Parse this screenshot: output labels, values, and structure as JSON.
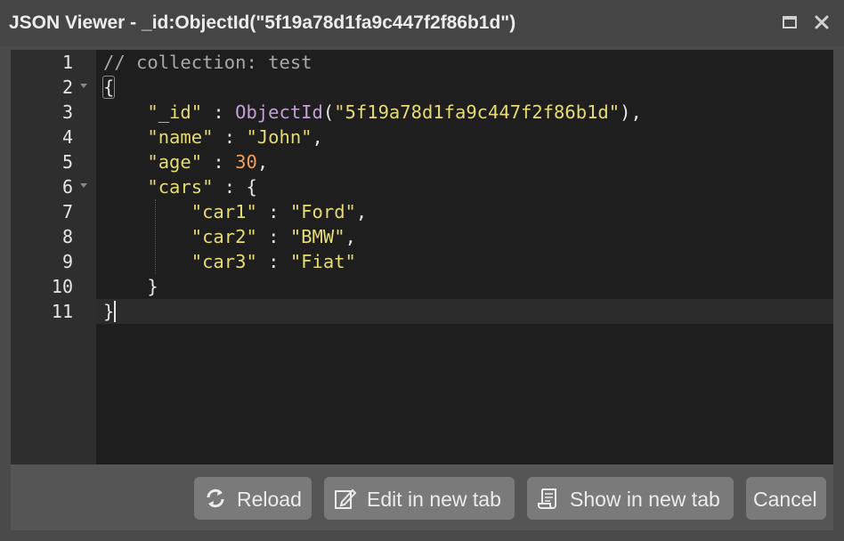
{
  "window": {
    "title": "JSON Viewer - _id:ObjectId(\"5f19a78d1fa9c447f2f86b1d\")"
  },
  "editor": {
    "line_numbers": [
      "1",
      "2",
      "3",
      "4",
      "5",
      "6",
      "7",
      "8",
      "9",
      "10",
      "11"
    ],
    "comment": "// collection: test",
    "open_brace": "{",
    "close_brace": "}",
    "id_key": "\"_id\"",
    "id_func": "ObjectId",
    "id_value": "\"5f19a78d1fa9c447f2f86b1d\"",
    "name_key": "\"name\"",
    "name_value": "\"John\"",
    "age_key": "\"age\"",
    "age_value": "30",
    "cars_key": "\"cars\"",
    "car1_key": "\"car1\"",
    "car1_value": "\"Ford\"",
    "car2_key": "\"car2\"",
    "car2_value": "\"BMW\"",
    "car3_key": "\"car3\"",
    "car3_value": "\"Fiat\"",
    "sep": " : ",
    "comma": ",",
    "lparen": "(",
    "rparen_comma": "),",
    "inner_open": "{"
  },
  "footer": {
    "reload_label": "Reload",
    "edit_label": "Edit in new tab",
    "show_label": "Show in new tab",
    "cancel_label": "Cancel"
  },
  "colors": {
    "string": "#e6db74",
    "number": "#f0a060",
    "function": "#c3a0d8",
    "comment": "#a8a8a8"
  }
}
